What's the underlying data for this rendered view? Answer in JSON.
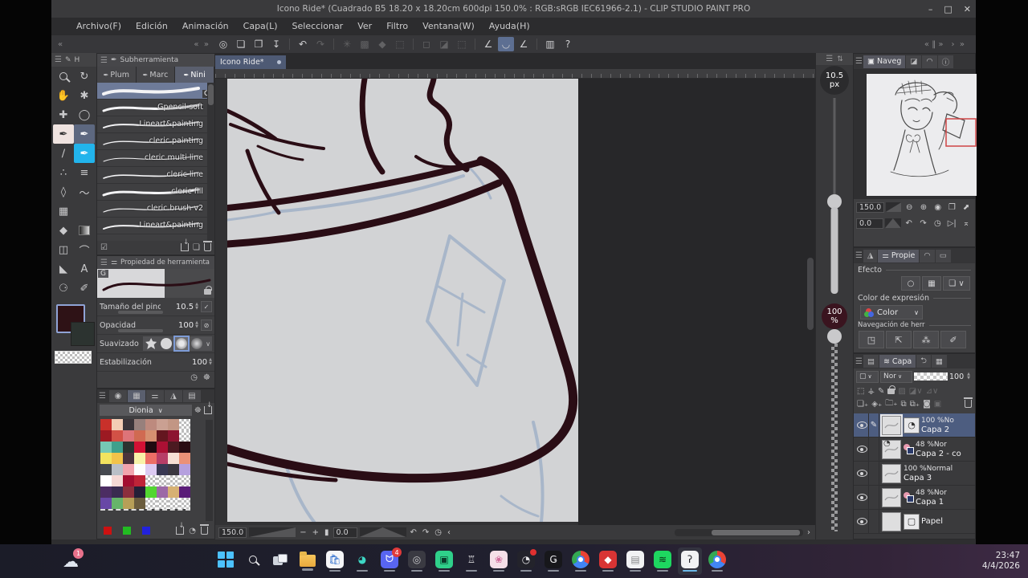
{
  "window": {
    "title": "Icono Ride* (Cuadrado B5 18.20 x 18.20cm 600dpi 150.0% : RGB:sRGB IEC61966-2.1)  - CLIP STUDIO PAINT PRO",
    "controls": {
      "minimize": "–",
      "maximize": "□",
      "close": "✕"
    }
  },
  "menu": [
    "Archivo(F)",
    "Edición",
    "Animación",
    "Capa(L)",
    "Seleccionar",
    "Ver",
    "Filtro",
    "Ventana(W)",
    "Ayuda(H)"
  ],
  "cmdbar": {
    "left_chevrons": [
      "«",
      "«  »"
    ],
    "right_chevrons": [
      "«  ‖  »",
      "›  »"
    ],
    "icons": [
      {
        "name": "csp-logo-icon",
        "glyph": "◎"
      },
      {
        "name": "new-file-icon",
        "glyph": "❏"
      },
      {
        "name": "open-file-icon",
        "glyph": "❐"
      },
      {
        "name": "save-file-icon",
        "glyph": "↧"
      },
      {
        "name": "sep"
      },
      {
        "name": "undo-icon",
        "glyph": "↶"
      },
      {
        "name": "redo-icon",
        "glyph": "↷",
        "dim": true
      },
      {
        "name": "sep"
      },
      {
        "name": "clear-icon",
        "glyph": "✳",
        "dim": true
      },
      {
        "name": "paste-icon",
        "glyph": "▩",
        "dim": true
      },
      {
        "name": "fill-icon",
        "glyph": "◆",
        "dim": true
      },
      {
        "name": "crop-icon",
        "glyph": "⬚",
        "dim": true
      },
      {
        "name": "sep"
      },
      {
        "name": "deselect-icon",
        "glyph": "◻",
        "dim": true
      },
      {
        "name": "invert-selection-icon",
        "glyph": "◪",
        "dim": true
      },
      {
        "name": "selection-border-icon",
        "glyph": "⬚",
        "dim": true
      },
      {
        "name": "sep"
      },
      {
        "name": "snap-ruler-icon",
        "glyph": "∠"
      },
      {
        "name": "snap-special-ruler-icon",
        "glyph": "◡",
        "active": true
      },
      {
        "name": "snap-guide-icon",
        "glyph": "∠"
      },
      {
        "name": "sep"
      },
      {
        "name": "material-panel-icon",
        "glyph": "▥"
      },
      {
        "name": "help-icon",
        "glyph": "?"
      }
    ]
  },
  "toolbox": {
    "tab": "H",
    "tools": [
      {
        "name": "zoom-tool",
        "glyph": "mag"
      },
      {
        "name": "rotate-view-tool",
        "glyph": "↻"
      },
      {
        "name": "hand-tool",
        "glyph": "✋"
      },
      {
        "name": "object-tool",
        "glyph": "✱"
      },
      {
        "name": "move-layer-tool",
        "glyph": "✚"
      },
      {
        "name": "lasso-tool",
        "glyph": "◯"
      },
      {
        "name": "pen-tool",
        "glyph": "✒",
        "bg": "#efe3e0"
      },
      {
        "name": "pencil-tool",
        "glyph": "✒",
        "bg": "#5d6880"
      },
      {
        "name": "eyedropper-tool",
        "glyph": "∕"
      },
      {
        "name": "brush-tool",
        "glyph": "✒",
        "bg": "#22b4ec"
      },
      {
        "name": "airbrush-tool",
        "glyph": "∴"
      },
      {
        "name": "decoration-tool",
        "glyph": "≡"
      },
      {
        "name": "eraser-tool",
        "glyph": "◊"
      },
      {
        "name": "blend-tool",
        "glyph": "～"
      },
      {
        "name": "fill-mesh-tool",
        "glyph": "▦"
      },
      {
        "name": "",
        "glyph": ""
      },
      {
        "name": "fill-tool",
        "glyph": "◆"
      },
      {
        "name": "gradient-tool",
        "glyph": "grad"
      },
      {
        "name": "frame-border-tool",
        "glyph": "◫"
      },
      {
        "name": "figure-tool",
        "glyph": "⌒"
      },
      {
        "name": "polyline-tool",
        "glyph": "◣"
      },
      {
        "name": "text-tool",
        "glyph": "A"
      },
      {
        "name": "balloon-tool",
        "glyph": "⚆"
      },
      {
        "name": "correct-line-tool",
        "glyph": "✐"
      }
    ],
    "primary_color": "#2e1216",
    "secondary_color": "#2c3330"
  },
  "subtool": {
    "header": "Subherramienta",
    "tabs": [
      {
        "label": "Plum",
        "active": false
      },
      {
        "label": "Marc",
        "active": false
      },
      {
        "label": "Nini",
        "active": true
      }
    ],
    "selected_badge": "G",
    "brushes": [
      {
        "name": "",
        "selected": true,
        "w": 4
      },
      {
        "name": "Gpencil-soft",
        "w": 3
      },
      {
        "name": "Lineart&painting",
        "w": 2
      },
      {
        "name": "cleric painting",
        "w": 1.4
      },
      {
        "name": "cleric multi line",
        "w": 1
      },
      {
        "name": "cleric line",
        "w": 1.6
      },
      {
        "name": "cleric fill",
        "w": 3
      },
      {
        "name": "cleric brush v2",
        "w": 1.2
      },
      {
        "name": "Lineart&painting",
        "w": 2
      }
    ]
  },
  "tool_property": {
    "header": "Propiedad de herramienta",
    "badge": "G",
    "params": [
      {
        "label": "Tamaño del pincel",
        "value": "10.5",
        "button": "✓",
        "slider": true
      },
      {
        "label": "Opacidad",
        "value": "100",
        "button": "⊘",
        "slider": true
      },
      {
        "label": "Suavizado",
        "value": "",
        "dots": true
      },
      {
        "label": "Estabilización",
        "value": "100"
      }
    ]
  },
  "palette": {
    "dropdown": "Dionia",
    "rows": [
      [
        "#c8302a",
        "#f3cdb4",
        "#3a3439",
        "#97807c",
        "#bd8a7e",
        "#caa092",
        "#c29684",
        null
      ],
      [
        "#9c1a22",
        "#d25146",
        "#dd7479",
        "#d06a52",
        "#d68f70",
        "#64161f",
        "#8c1430",
        null
      ],
      [
        "#76c7b4",
        "#3fa08c",
        "#2b3330",
        "#d21134",
        "#1f0a10",
        "#ac1034",
        "#4b1a21",
        "#2a0d13"
      ],
      [
        "#f2e35f",
        "#f2c34a",
        "#4a333c",
        "#f8f2a8",
        "#ec6e66",
        "#b73e67",
        "#f7e0d5",
        "#eb9177"
      ],
      [
        "#45494f",
        "#b9bfc7",
        "#f2a4ad",
        "#fdfdfd",
        "#dccaf2",
        "#383852",
        "#3a3740",
        "#b5a0de"
      ],
      [
        "#ffffff",
        "#f5d8d5",
        "#a30e31",
        "#bf2438",
        null,
        null,
        null,
        null
      ],
      [
        "#4c2d63",
        "#3a2b50",
        "#8c2f3d",
        "#241f37",
        "#52d631",
        "#9c69a6",
        "#d7b173",
        "#5a1c78"
      ],
      [
        "#6847a6",
        "#66b46a",
        "#b79f57",
        "#6a5c3d",
        null,
        null,
        null,
        null
      ]
    ],
    "footer_colors": [
      "#cc1111",
      "#22bb22",
      "#2222dd"
    ]
  },
  "document": {
    "tab": "Icono Ride*",
    "zoom": "150.0",
    "rotation": "0.0",
    "ink_color": "#2a0d15",
    "sketch_color": "#a8b6c9",
    "canvas_bg": "#d2d3d5"
  },
  "sliders": {
    "brush_size_value": "10.5",
    "brush_size_unit": "px",
    "opacity_value": "100",
    "opacity_unit": "%"
  },
  "navigator": {
    "tab": "Naveg",
    "zoom": "150.0",
    "rotation": "0.0"
  },
  "layer_property": {
    "tab": "Propie",
    "effect_label": "Efecto",
    "expression_label": "Color de expresión",
    "expression_value": "Color",
    "nav_label": "Navegación de herr"
  },
  "layers": {
    "tab": "Capa",
    "blend_mode": "Nor",
    "opacity": "100",
    "items": [
      {
        "meta": "100 %No",
        "name": "Capa 2",
        "selected": true,
        "editing": true,
        "draftbox": true
      },
      {
        "meta": "48 %Nor",
        "name": "Capa 2 - co",
        "colorbadge": true,
        "draftthumb": true
      },
      {
        "meta": "100 %Normal",
        "name": "Capa 3"
      },
      {
        "meta": "48 %Nor",
        "name": "Capa 1",
        "colorbadge": true
      },
      {
        "meta": "",
        "name": "Papel",
        "paper": true
      }
    ]
  },
  "taskbar": {
    "weather_badge": "1",
    "clock_time": "23:47",
    "clock_date": "4/4/2026",
    "apps": [
      {
        "name": "start-button",
        "kind": "wingrid"
      },
      {
        "name": "search-button",
        "kind": "mag"
      },
      {
        "name": "task-view-button",
        "kind": "taskview"
      },
      {
        "name": "file-explorer",
        "kind": "folder"
      },
      {
        "name": "microsoft-store",
        "kind": "box",
        "bg": "#f5f5f7",
        "glyph": "🛍",
        "fg": "#2266cc"
      },
      {
        "name": "edge-browser",
        "kind": "box",
        "bg": "transparent",
        "glyph": "◕",
        "fg": "#3dd6c4"
      },
      {
        "name": "discord",
        "kind": "box",
        "bg": "#5865f2",
        "glyph": "ᗢ",
        "fg": "#fff",
        "badge": "4"
      },
      {
        "name": "swirl-app",
        "kind": "box",
        "bg": "#3a3a42",
        "glyph": "◎",
        "fg": "#c9c9cb"
      },
      {
        "name": "green-lock-app",
        "kind": "box",
        "bg": "#2fd08a",
        "glyph": "▣",
        "fg": "#0a3a2a"
      },
      {
        "name": "badge-app",
        "kind": "box",
        "bg": "transparent",
        "glyph": "♖",
        "fg": "#e8e8ea"
      },
      {
        "name": "photos-app",
        "kind": "box",
        "bg": "#f5dfe8",
        "glyph": "❀",
        "fg": "#d06a9a"
      },
      {
        "name": "obs-studio",
        "kind": "box",
        "bg": "#23232b",
        "glyph": "◔",
        "fg": "#e8e8ea",
        "reddot": true
      },
      {
        "name": "logitech-g",
        "kind": "box",
        "bg": "#17171b",
        "glyph": "Ǥ",
        "fg": "#e8e8ea"
      },
      {
        "name": "chrome-profile-1",
        "kind": "chrome"
      },
      {
        "name": "red-diamond-app",
        "kind": "box",
        "bg": "#d83434",
        "glyph": "◆",
        "fg": "#fff"
      },
      {
        "name": "notepad",
        "kind": "box",
        "bg": "#f2f2f4",
        "glyph": "▤",
        "fg": "#8a8a8c"
      },
      {
        "name": "spotify",
        "kind": "box",
        "bg": "#1ed760",
        "glyph": "≋",
        "fg": "#0a2a12"
      },
      {
        "name": "clip-studio-paint",
        "kind": "box",
        "bg": "#f2f2f4",
        "glyph": "ʔ",
        "fg": "#23232b",
        "active": true
      },
      {
        "name": "chrome-profile-2",
        "kind": "chrome"
      }
    ]
  }
}
